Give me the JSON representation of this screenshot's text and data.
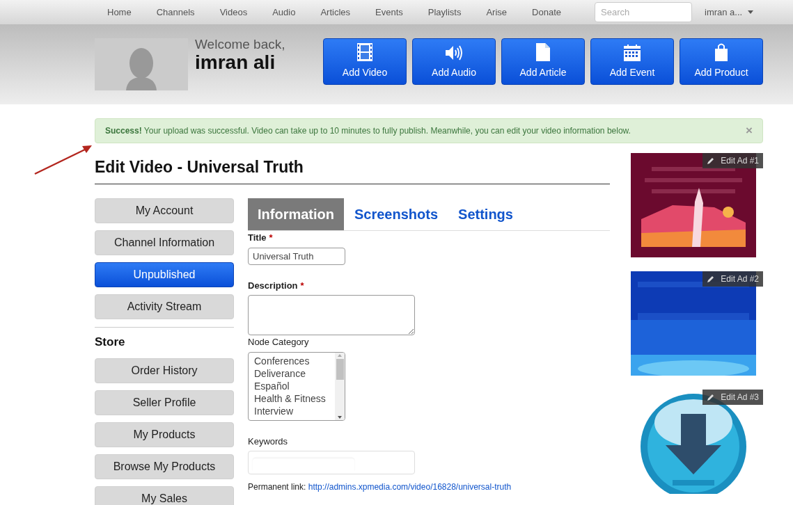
{
  "nav": {
    "items": [
      "Home",
      "Channels",
      "Videos",
      "Audio",
      "Articles",
      "Events",
      "Playlists",
      "Arise",
      "Donate"
    ],
    "search": {
      "placeholder": "Search"
    },
    "user": "imran a..."
  },
  "header": {
    "greeting": "Welcome back,",
    "name": "imran ali",
    "actions": [
      {
        "kind": "video",
        "label": "Add Video"
      },
      {
        "kind": "audio",
        "label": "Add Audio"
      },
      {
        "kind": "article",
        "label": "Add Article"
      },
      {
        "kind": "event",
        "label": "Add Event"
      },
      {
        "kind": "product",
        "label": "Add Product"
      }
    ]
  },
  "alert": {
    "text": "**Success!** Your upload was successful. Video can take up to 10 minutes to fully publish. Meanwhile, you can edit your video information below.",
    "close": "×"
  },
  "page_title": "Edit Video - Universal Truth",
  "sidebar": {
    "items": [
      {
        "label": "My Account",
        "selected": false
      },
      {
        "label": "Channel Information",
        "selected": false
      },
      {
        "label": "Unpublished",
        "selected": true
      },
      {
        "label": "Activity Stream",
        "selected": false
      }
    ],
    "store_heading": "Store",
    "store_items": [
      {
        "label": "Order History",
        "selected": false
      },
      {
        "label": "Seller Profile",
        "selected": false
      },
      {
        "label": "My Products",
        "selected": false
      },
      {
        "label": "Browse My Products",
        "selected": false
      },
      {
        "label": "My Sales",
        "selected": false
      }
    ]
  },
  "tabs": [
    {
      "label": "Information",
      "selected": true
    },
    {
      "label": "Screenshots",
      "selected": false
    },
    {
      "label": "Settings",
      "selected": false
    }
  ],
  "form": {
    "title": {
      "label": "Title",
      "required_mark": "*",
      "value": "Universal Truth"
    },
    "description": {
      "label": "Description",
      "required_mark": "*"
    },
    "category": {
      "label": "Node Category",
      "options": [
        "Conferences",
        "Deliverance",
        "Español",
        "Health & Fitness",
        "Interview"
      ]
    },
    "keywords": {
      "label": "Keywords"
    },
    "permanent_link": {
      "label": "Permanent link:",
      "url": "http://admins.xpmedia.com/video/16828/universal-truth"
    }
  },
  "ads": [
    {
      "kind": "picture",
      "edit": "Edit Ad #1"
    },
    {
      "kind": "picture",
      "edit": "Edit Ad #2"
    },
    {
      "kind": "picture",
      "edit": "Edit Ad #3"
    }
  ]
}
